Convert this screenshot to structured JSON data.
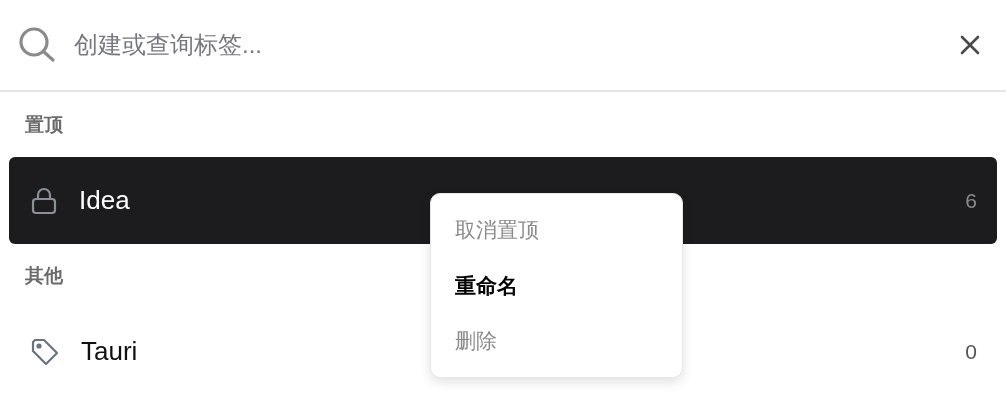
{
  "search": {
    "placeholder": "创建或查询标签..."
  },
  "sections": [
    {
      "title": "置顶",
      "tags": [
        {
          "name": "Idea",
          "count": "6",
          "kind": "lock",
          "selected": true
        }
      ]
    },
    {
      "title": "其他",
      "tags": [
        {
          "name": "Tauri",
          "count": "0",
          "kind": "tag",
          "selected": false
        }
      ]
    }
  ],
  "context_menu": {
    "items": [
      {
        "label": "取消置顶",
        "selected": false
      },
      {
        "label": "重命名",
        "selected": true
      },
      {
        "label": "删除",
        "selected": false
      }
    ]
  }
}
